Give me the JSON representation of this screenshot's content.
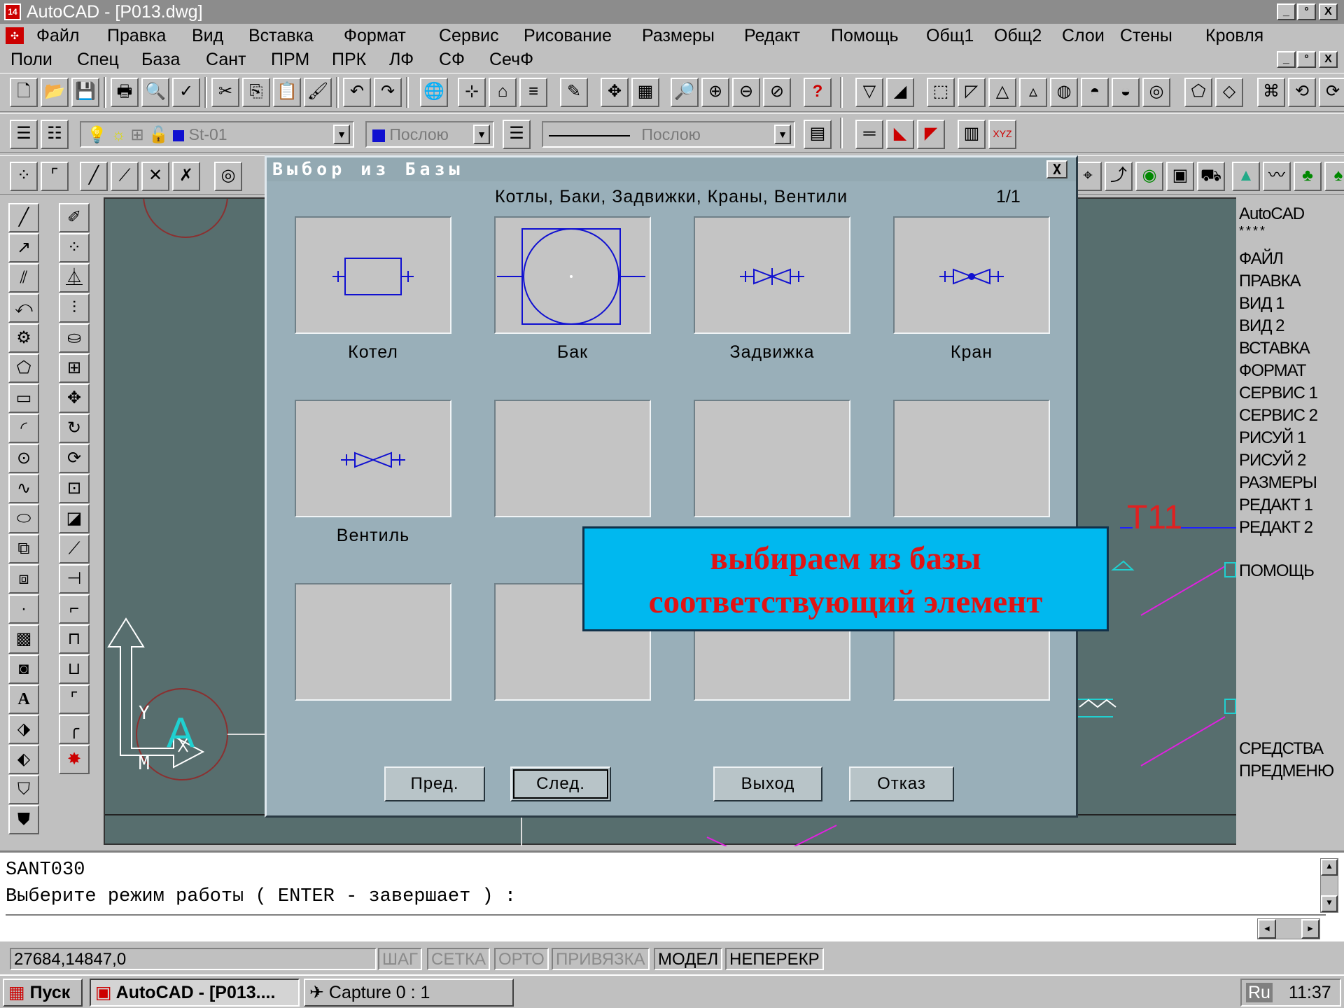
{
  "window": {
    "title": "AutoCAD - [P013.dwg]",
    "app_icon": "14",
    "min": "_",
    "max": "°",
    "close": "X"
  },
  "menu1": [
    "Файл",
    "Правка",
    "Вид",
    "Вставка",
    "Формат",
    "Сервис",
    "Рисование",
    "Размеры",
    "Редакт",
    "Помощь",
    "Общ1",
    "Общ2",
    "Слои",
    "Стены",
    "Кровля"
  ],
  "menu2": [
    "Поли",
    "Спец",
    "База",
    "Сант",
    "ПРМ",
    "ПРК",
    "ЛФ",
    "СФ",
    "СечФ"
  ],
  "properties": {
    "layer": "St-01",
    "color": "Послою",
    "linetype": "Послою"
  },
  "dialog": {
    "title": "Выбор из Базы",
    "close": "X",
    "category": "Котлы, Баки, Задвижки, Краны, Вентили",
    "page": "1/1",
    "tiles": [
      {
        "label": "Котел",
        "icon": "boiler-symbol"
      },
      {
        "label": "Бак",
        "icon": "tank-symbol"
      },
      {
        "label": "Задвижка",
        "icon": "gate-valve-symbol"
      },
      {
        "label": "Кран",
        "icon": "cock-valve-symbol"
      },
      {
        "label": "Вентиль",
        "icon": "stop-valve-symbol"
      },
      {
        "label": "",
        "icon": ""
      },
      {
        "label": "",
        "icon": ""
      },
      {
        "label": "",
        "icon": ""
      },
      {
        "label": "",
        "icon": ""
      },
      {
        "label": "",
        "icon": ""
      },
      {
        "label": "",
        "icon": ""
      },
      {
        "label": "",
        "icon": ""
      }
    ],
    "buttons": {
      "prev": "Пред.",
      "next": "След.",
      "exit": "Выход",
      "cancel": "Отказ"
    }
  },
  "callout": {
    "line1": "выбираем из базы",
    "line2": "соответствующий элемент"
  },
  "drawing": {
    "label_t11": "T11",
    "label_a": "A",
    "label_y": "Y",
    "label_m": "M"
  },
  "side_menu": [
    "AutoCAD",
    "* * * *",
    "ФАЙЛ",
    "ПРАВКА",
    "ВИД 1",
    "ВИД 2",
    "ВСТАВКА",
    "ФОРМАТ",
    "СЕРВИС 1",
    "СЕРВИС 2",
    "РИСУЙ 1",
    "РИСУЙ 2",
    "РАЗМЕРЫ",
    "РЕДАКТ 1",
    "РЕДАКТ 2",
    "ПОМОЩЬ",
    "СРЕДСТВА",
    "ПРЕДМЕНЮ"
  ],
  "command": {
    "line1": "SANT030",
    "line2": "Выберите режим работы  ( ENTER - завершает ) :"
  },
  "status": {
    "coords": "27684,14847,0",
    "modes": [
      "ШАГ",
      "СЕТКА",
      "ОРТО",
      "ПРИВЯЗКА",
      "МОДЕЛ",
      "НЕПЕРЕКР"
    ]
  },
  "taskbar": {
    "start": "Пуск",
    "task1": "AutoCAD - [P013....",
    "task2": "Capture 0 : 1",
    "lang": "Ru",
    "time": "11:37"
  },
  "colors": {
    "symbol": "#1010d0",
    "drawing_bg": "#576e6e",
    "dialog_bg": "#99afb9",
    "callout_bg": "#00b8ef",
    "callout_text": "#e01414"
  }
}
